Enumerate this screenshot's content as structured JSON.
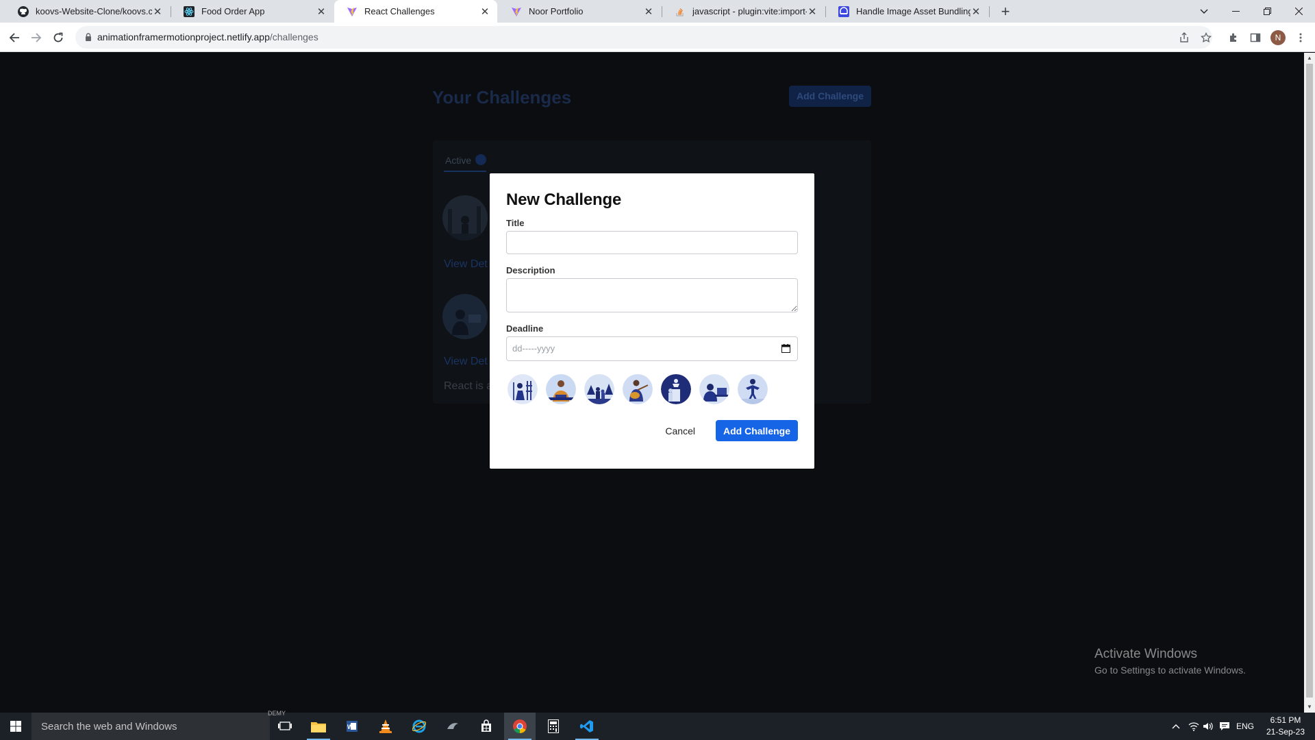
{
  "browser": {
    "tabs": [
      {
        "title": "koovs-Website-Clone/koovs.com",
        "favicon": "github-icon",
        "active": false
      },
      {
        "title": "Food Order App",
        "favicon": "react-icon",
        "active": false
      },
      {
        "title": "React Challenges",
        "favicon": "vite-icon",
        "active": true
      },
      {
        "title": "Noor Portfolio",
        "favicon": "vite-icon",
        "active": false
      },
      {
        "title": "javascript - plugin:vite:import-an",
        "favicon": "stackoverflow-icon",
        "active": false
      },
      {
        "title": "Handle Image Asset Bundling us",
        "favicon": "dev-icon",
        "active": false
      }
    ],
    "url_host": "animationframermotionproject.netlify.app",
    "url_path": "/challenges",
    "profile_initial": "N"
  },
  "background_page": {
    "heading": "Your Challenges",
    "add_button": "Add Challenge",
    "tab_active": "Active",
    "view_details_1": "View Det",
    "view_details_2": "View Det",
    "snippet": "React is a"
  },
  "modal": {
    "title": "New Challenge",
    "title_label": "Title",
    "title_value": "",
    "description_label": "Description",
    "description_value": "",
    "deadline_label": "Deadline",
    "deadline_placeholder": "dd-----yyyy",
    "images": [
      "painter",
      "plumber",
      "people-park",
      "guitarist",
      "person-lamp",
      "desk-worker",
      "athlete"
    ],
    "cancel_label": "Cancel",
    "submit_label": "Add Challenge"
  },
  "watermark": {
    "line1": "Activate Windows",
    "line2": "Go to Settings to activate Windows."
  },
  "taskbar": {
    "search_placeholder": "Search the web and Windows",
    "demo_label": "DEMY",
    "language": "ENG",
    "time": "6:51 PM",
    "date": "21-Sep-23"
  },
  "colors": {
    "accent": "#1565e6",
    "page_background": "#0b0d10",
    "overlay_link": "#1a3463"
  }
}
